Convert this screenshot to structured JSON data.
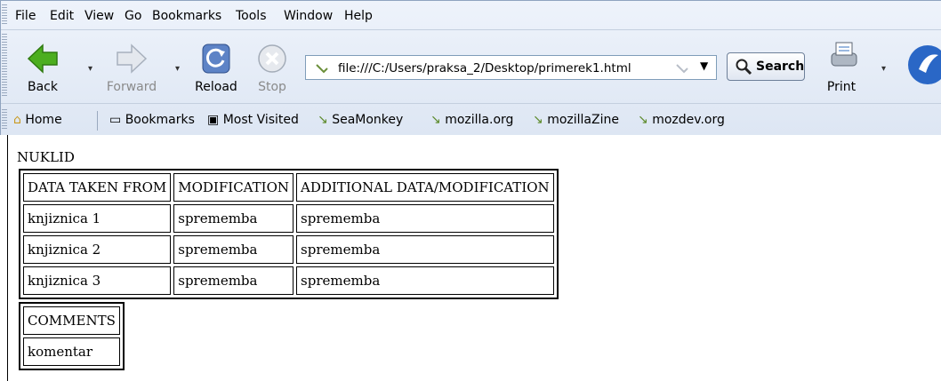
{
  "menu": [
    "File",
    "Edit",
    "View",
    "Go",
    "Bookmarks",
    "Tools",
    "Window",
    "Help"
  ],
  "toolbar": {
    "back": "Back",
    "forward": "Forward",
    "reload": "Reload",
    "stop": "Stop",
    "url": "file:///C:/Users/praksa_2/Desktop/primerek1.html",
    "search": "Search",
    "print": "Print"
  },
  "bookmarks": [
    "Home",
    "Bookmarks",
    "Most Visited",
    "SeaMonkey",
    "mozilla.org",
    "mozillaZine",
    "mozdev.org"
  ],
  "page": {
    "title": "NUKLID",
    "table1": {
      "headers": [
        "DATA TAKEN FROM",
        "MODIFICATION",
        "ADDITIONAL DATA/MODIFICATION"
      ],
      "rows": [
        [
          "knjiznica 1",
          "sprememba",
          "sprememba"
        ],
        [
          "knjiznica 2",
          "sprememba",
          "sprememba"
        ],
        [
          "knjiznica 3",
          "sprememba",
          "sprememba"
        ]
      ]
    },
    "table2": {
      "header": "COMMENTS",
      "value": "komentar"
    }
  }
}
